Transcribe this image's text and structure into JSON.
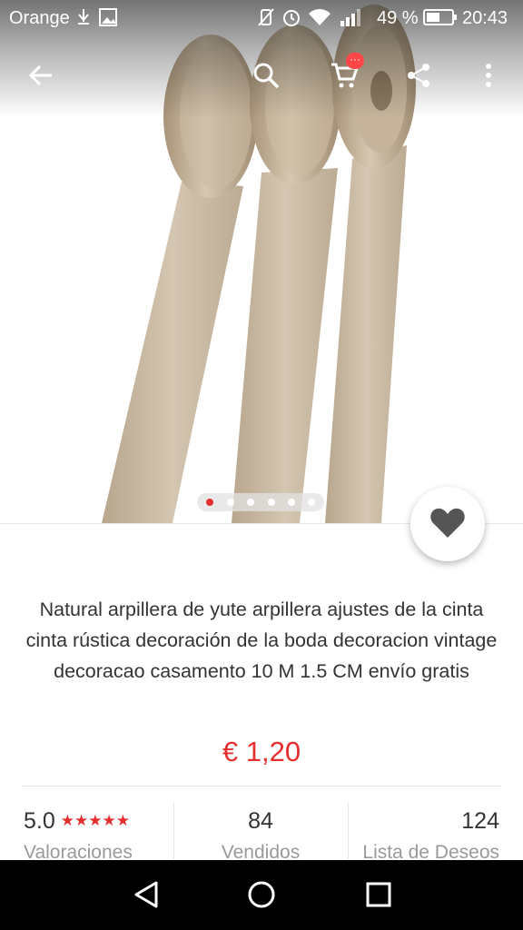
{
  "status_bar": {
    "carrier": "Orange",
    "battery": "49 %",
    "time": "20:43"
  },
  "toolbar": {
    "cart_badge": "···",
    "icons": [
      "back-arrow-icon",
      "search-icon",
      "cart-icon",
      "share-icon",
      "more-vert-icon"
    ]
  },
  "gallery": {
    "image_count": 6,
    "current_index": 0
  },
  "product": {
    "title": "Natural arpillera de yute arpillera ajustes de la cinta cinta rústica decoración de la boda decoracion vintage decoracao casamento 10 M 1.5 CM envío gratis",
    "price": "€ 1,20"
  },
  "stats": {
    "rating": {
      "value": "5.0",
      "stars": "★★★★★",
      "label": "Valoraciones"
    },
    "sold": {
      "value": "84",
      "label": "Vendidos"
    },
    "wishlist": {
      "value": "124",
      "label": "Lista de Deseos"
    }
  },
  "colors": {
    "accent": "#e62e2e",
    "text": "#333333",
    "muted": "#999999",
    "jute": "#c9b9a2"
  }
}
